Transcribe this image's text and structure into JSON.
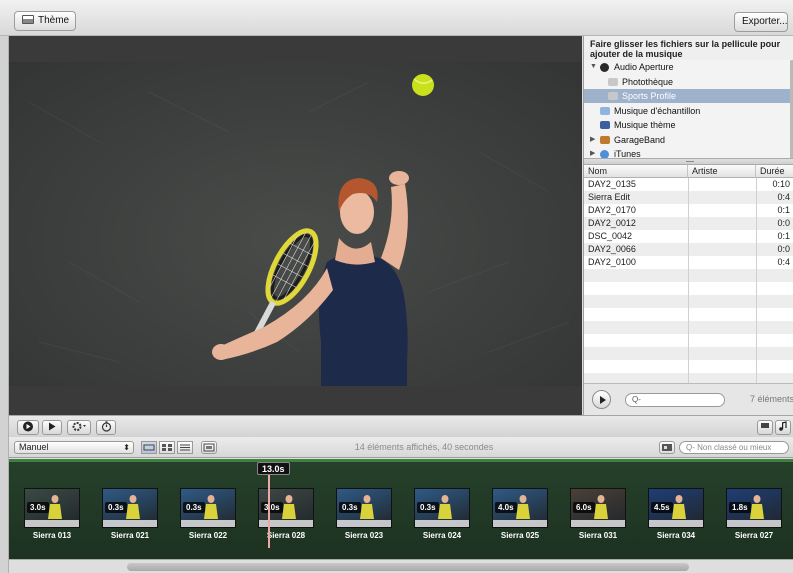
{
  "toolbar": {
    "theme_label": "Thème",
    "export_label": "Exporter..."
  },
  "browser": {
    "title": "Faire glisser les fichiers sur la pellicule pour ajouter de la musique",
    "tree": [
      {
        "label": "Audio Aperture",
        "expanded": true,
        "icon": "aperture-icon",
        "level": 0
      },
      {
        "label": "Photothèque",
        "icon": "library-icon",
        "level": 1
      },
      {
        "label": "Sports Profile",
        "icon": "library-icon",
        "level": 1,
        "selected": true
      },
      {
        "label": "Musique d'échantillon",
        "icon": "music-folder-icon",
        "level": 0
      },
      {
        "label": "Musique thème",
        "icon": "theme-music-icon",
        "level": 0
      },
      {
        "label": "GarageBand",
        "expanded": false,
        "icon": "guitar-icon",
        "level": 0
      },
      {
        "label": "iTunes",
        "expanded": false,
        "icon": "itunes-icon",
        "level": 0
      }
    ],
    "columns": [
      "Nom",
      "Artiste",
      "Durée"
    ],
    "rows": [
      {
        "name": "DAY2_0135",
        "artist": "",
        "duration": "0:10"
      },
      {
        "name": "Sierra Edit",
        "artist": "",
        "duration": "0:4"
      },
      {
        "name": "DAY2_0170",
        "artist": "",
        "duration": "0:1"
      },
      {
        "name": "DAY2_0012",
        "artist": "",
        "duration": "0:0"
      },
      {
        "name": "DSC_0042",
        "artist": "",
        "duration": "0:1"
      },
      {
        "name": "DAY2_0066",
        "artist": "",
        "duration": "0:0"
      },
      {
        "name": "DAY2_0100",
        "artist": "",
        "duration": "0:4"
      }
    ],
    "search_placeholder": "Q-",
    "count": "7 éléments"
  },
  "controls": {
    "mode_select": "Manuel",
    "status": "14 éléments affichés, 40 secondes",
    "filter_placeholder": "Q- Non classé ou mieux"
  },
  "filmstrip": {
    "playhead": "13.0s",
    "clips": [
      {
        "label": "Sierra 013",
        "duration": "3.0s",
        "tone": "#3a4a44"
      },
      {
        "label": "Sierra 021",
        "duration": "0.3s",
        "tone": "#2f5a86"
      },
      {
        "label": "Sierra 022",
        "duration": "0.3s",
        "tone": "#2f5a86"
      },
      {
        "label": "Sierra 028",
        "duration": "3.0s",
        "tone": "#3e4845"
      },
      {
        "label": "Sierra 023",
        "duration": "0.3s",
        "tone": "#2f5a86"
      },
      {
        "label": "Sierra 024",
        "duration": "0.3s",
        "tone": "#2f5a86"
      },
      {
        "label": "Sierra 025",
        "duration": "4.0s",
        "tone": "#2f5a86"
      },
      {
        "label": "Sierra 031",
        "duration": "6.0s",
        "tone": "#4a4038"
      },
      {
        "label": "Sierra 034",
        "duration": "4.5s",
        "tone": "#1f3e75"
      },
      {
        "label": "Sierra 027",
        "duration": "1.8s",
        "tone": "#1f3e75"
      }
    ]
  },
  "colors": {
    "selection": "#9fb2cb",
    "strip_bg": "#25402a",
    "accent_green": "#3f7f3f",
    "playhead": "#f0a7a7"
  }
}
